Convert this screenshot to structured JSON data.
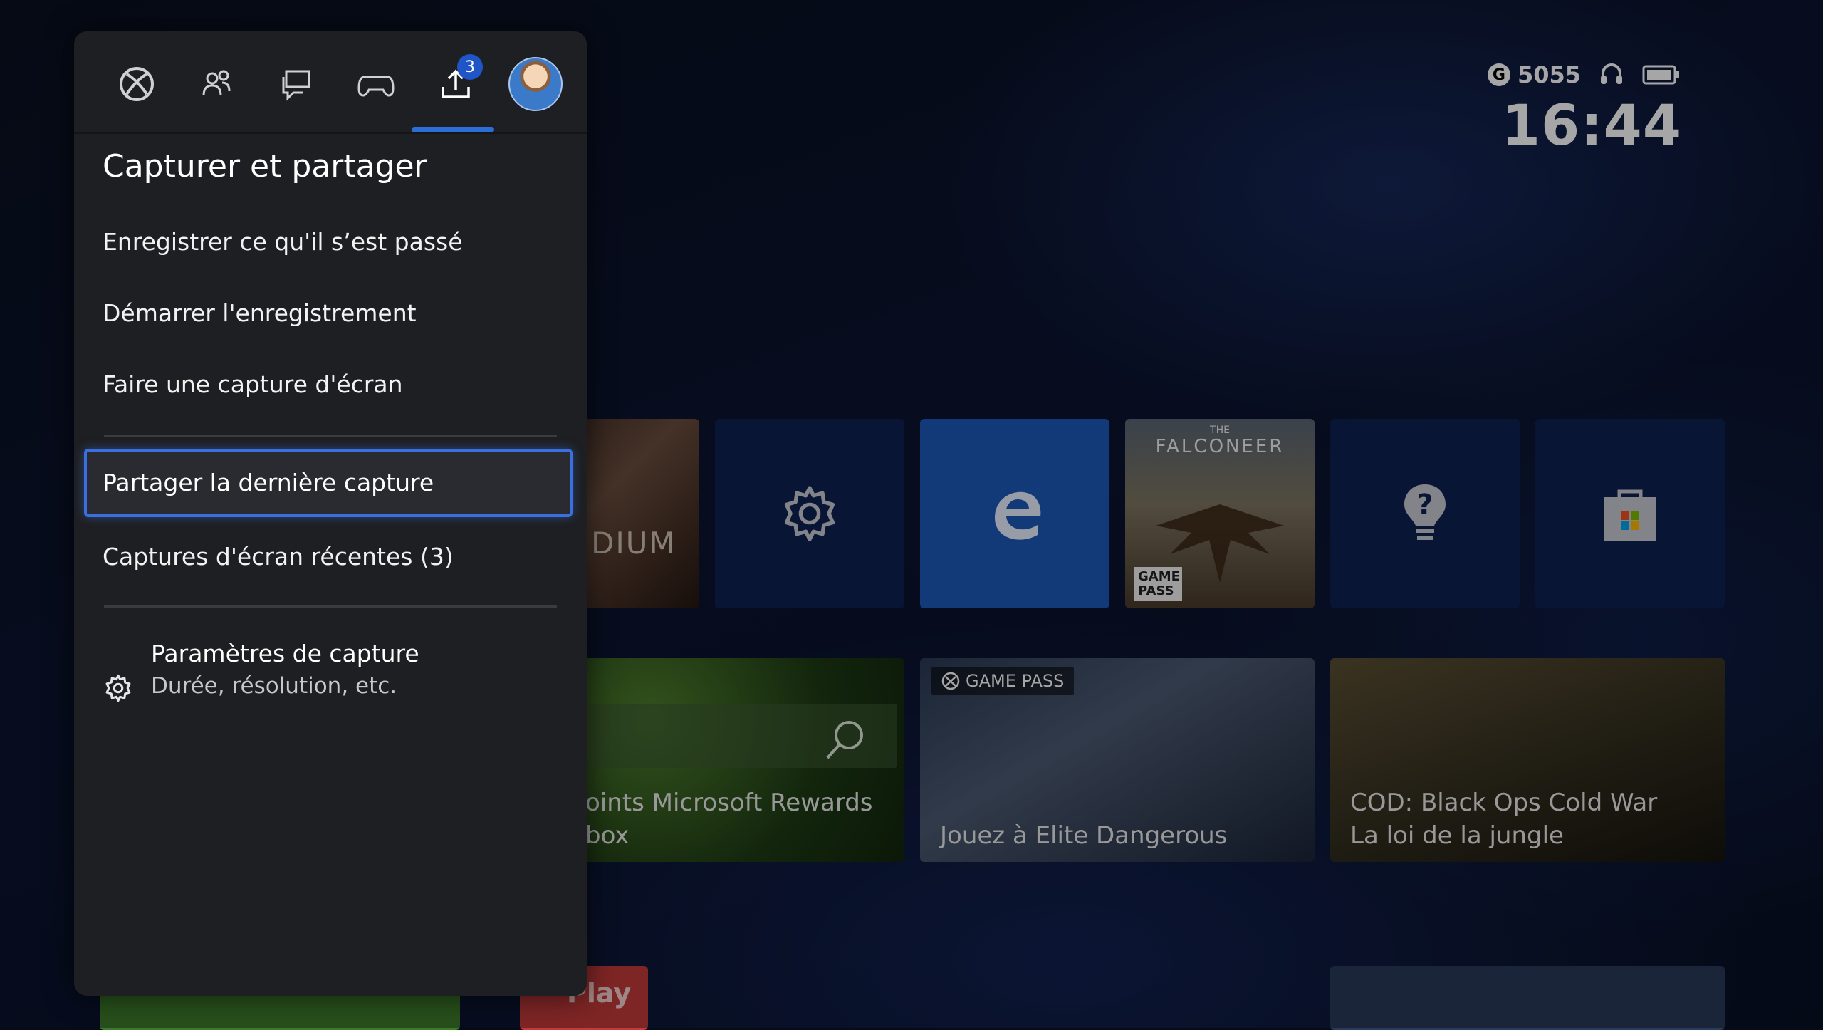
{
  "status": {
    "gamerscore_icon": "G",
    "gamerscore": "5055",
    "headset_icon": "headset-icon",
    "battery_icon": "battery-icon",
    "time": "16:44"
  },
  "guide": {
    "tabs": [
      {
        "name": "xbox-icon"
      },
      {
        "name": "people-icon"
      },
      {
        "name": "chat-icon"
      },
      {
        "name": "controller-icon"
      },
      {
        "name": "share-icon",
        "badge": "3"
      },
      {
        "name": "profile-avatar"
      }
    ],
    "title": "Capturer et partager",
    "items": [
      "Enregistrer ce qu'il s’est passé",
      "Démarrer l'enregistrement",
      "Faire une capture d'écran",
      "Partager la dernière capture",
      "Captures d'écran récentes (3)"
    ],
    "settings": {
      "title": "Paramètres de capture",
      "subtitle": "Durée, résolution, etc."
    }
  },
  "tiles": {
    "game_partial_text": "DIUM",
    "falconeer_title_small": "THE",
    "falconeer_title": "FALCONEER",
    "falconeer_tag": "GAME PASS",
    "rewards_line1": "oints Microsoft Rewards",
    "rewards_line2": "box",
    "elite_tag": "GAME PASS",
    "elite_label": "Jouez à Elite Dangerous",
    "cod_line1": "COD: Black Ops Cold War",
    "cod_line2": "La loi de la jungle",
    "play_label": "Play"
  },
  "colors": {
    "panel_bg": "#1e1f22",
    "accent": "#2d6dd8",
    "tile_dark": "#0f2150",
    "edge_blue": "#1c58b8"
  }
}
